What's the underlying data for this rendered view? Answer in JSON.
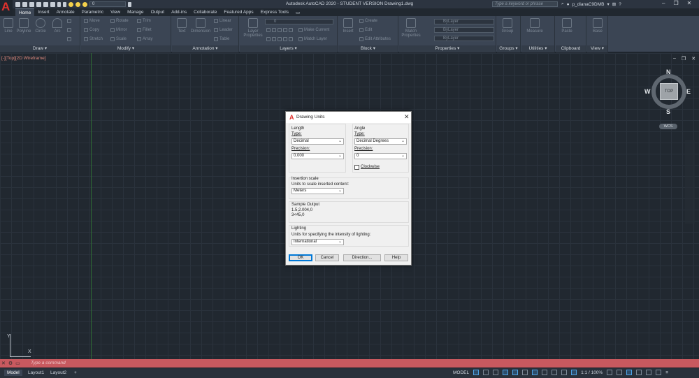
{
  "titlebar": {
    "title": "Autodesk AutoCAD 2020 - STUDENT VERSION    Drawing1.dwg",
    "layer_value": "0",
    "search_placeholder": "Type a keyword or phrase",
    "username": "p_dianaC9DMB"
  },
  "tabs": [
    "Home",
    "Insert",
    "Annotate",
    "Parametric",
    "View",
    "Manage",
    "Output",
    "Add-ins",
    "Collaborate",
    "Featured Apps",
    "Express Tools"
  ],
  "ribbon": {
    "draw": {
      "title": "Draw",
      "line": "Line",
      "polyline": "Polyline",
      "circle": "Circle",
      "arc": "Arc"
    },
    "modify": {
      "title": "Modify",
      "move": "Move",
      "copy": "Copy",
      "stretch": "Stretch",
      "rotate": "Rotate",
      "mirror": "Mirror",
      "scale": "Scale",
      "trim": "Trim",
      "fillet": "Fillet",
      "array": "Array"
    },
    "annotation": {
      "title": "Annotation",
      "text": "Text",
      "dimension": "Dimension",
      "linear": "Linear",
      "leader": "Leader",
      "table": "Table"
    },
    "layers": {
      "title": "Layers",
      "properties": "Layer Properties",
      "layer_value": "0",
      "make_current": "Make Current",
      "match_layer": "Match Layer"
    },
    "block": {
      "title": "Block",
      "insert": "Insert",
      "create": "Create",
      "edit": "Edit",
      "edit_attributes": "Edit Attributes"
    },
    "properties": {
      "title": "Properties",
      "match": "Match Properties",
      "bylayer1": "ByLayer",
      "bylayer2": "ByLayer",
      "bylayer3": "ByLayer"
    },
    "groups": {
      "title": "Groups",
      "group": "Group"
    },
    "utilities": {
      "title": "Utilities",
      "measure": "Measure"
    },
    "clipboard": {
      "title": "Clipboard",
      "paste": "Paste"
    },
    "view": {
      "title": "View",
      "base": "Base"
    }
  },
  "canvas": {
    "view_label": "[-][Top][2D Wireframe]",
    "viewcube": {
      "top": "TOP",
      "n": "N",
      "s": "S",
      "e": "E",
      "w": "W",
      "wcs": "WCS"
    },
    "ucs_x": "X",
    "ucs_y": "Y"
  },
  "command": {
    "placeholder": "Type a command"
  },
  "status": {
    "layouts": [
      "Model",
      "Layout1",
      "Layout2"
    ],
    "mode": "MODEL",
    "scale": "1:1 / 100%"
  },
  "dialog": {
    "title": "Drawing Units",
    "length": {
      "label": "Length",
      "type_label": "Type:",
      "type_value": "Decimal",
      "precision_label": "Precision:",
      "precision_value": "0.000"
    },
    "angle": {
      "label": "Angle",
      "type_label": "Type:",
      "type_value": "Decimal Degrees",
      "precision_label": "Precision:",
      "precision_value": "0",
      "clockwise_label": "Clockwise",
      "clockwise_checked": false
    },
    "insertion": {
      "label": "Insertion scale",
      "sub_label": "Units to scale inserted content:",
      "value": "Meters"
    },
    "sample": {
      "label": "Sample Output",
      "line1": "1.5,2.004,0",
      "line2": "3<45,0"
    },
    "lighting": {
      "label": "Lighting",
      "sub_label": "Units for specifying the intensity of lighting:",
      "value": "International"
    },
    "buttons": {
      "ok": "OK",
      "cancel": "Cancel",
      "direction": "Direction...",
      "help": "Help"
    }
  },
  "colors": {
    "accent": "#0078d7",
    "command_bar": "#c8595f",
    "canvas": "#212830",
    "logo_red": "#e0322d"
  }
}
